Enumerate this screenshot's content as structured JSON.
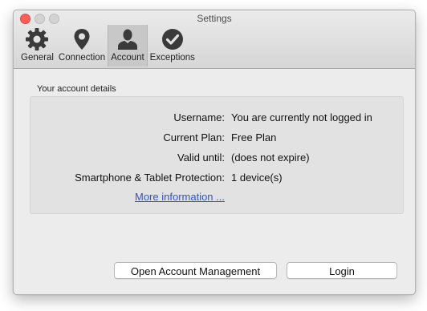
{
  "window": {
    "title": "Settings"
  },
  "toolbar": {
    "items": [
      {
        "label": "General",
        "icon": "gear-icon"
      },
      {
        "label": "Connection",
        "icon": "location-pin-icon"
      },
      {
        "label": "Account",
        "icon": "user-icon",
        "active": true
      },
      {
        "label": "Exceptions",
        "icon": "checkmark-circle-icon"
      }
    ]
  },
  "account": {
    "section_title": "Your account details",
    "rows": [
      {
        "key": "Username:",
        "value": "You are currently not logged in"
      },
      {
        "key": "Current Plan:",
        "value": "Free Plan"
      },
      {
        "key": "Valid until:",
        "value": "(does not expire)"
      },
      {
        "key": "Smartphone & Tablet Protection:",
        "value": "1 device(s)"
      }
    ],
    "more_link": "More information ..."
  },
  "buttons": {
    "manage": "Open Account Management",
    "login": "Login"
  },
  "colors": {
    "link": "#2a55d4",
    "close": "#fc5f57"
  }
}
